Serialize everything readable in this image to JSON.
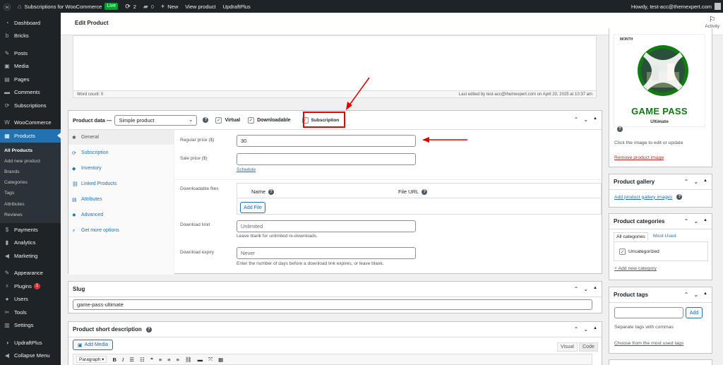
{
  "adminbar": {
    "site_name": "Subscriptions for WooCommerce",
    "live_badge": "Live",
    "updates_count": "2",
    "comments_count": "0",
    "new_label": "New",
    "view_product": "View product",
    "updraft": "UpdraftPlus",
    "howdy": "Howdy, test-acc@themexpert.com"
  },
  "sidebar": {
    "items": [
      {
        "label": "Dashboard",
        "icon": "dashboard-icon"
      },
      {
        "label": "Bricks",
        "icon": "bricks-icon"
      },
      {
        "label": "Posts",
        "icon": "pin-icon"
      },
      {
        "label": "Media",
        "icon": "media-icon"
      },
      {
        "label": "Pages",
        "icon": "pages-icon"
      },
      {
        "label": "Comments",
        "icon": "comments-icon"
      },
      {
        "label": "Subscriptions",
        "icon": "subscriptions-icon"
      },
      {
        "label": "WooCommerce",
        "icon": "woocommerce-icon"
      },
      {
        "label": "Products",
        "icon": "products-icon"
      }
    ],
    "submenu": [
      "All Products",
      "Add new product",
      "Brands",
      "Categories",
      "Tags",
      "Attributes",
      "Reviews"
    ],
    "items2": [
      {
        "label": "Payments",
        "icon": "payments-icon"
      },
      {
        "label": "Analytics",
        "icon": "analytics-icon"
      },
      {
        "label": "Marketing",
        "icon": "marketing-icon"
      },
      {
        "label": "Appearance",
        "icon": "appearance-icon"
      },
      {
        "label": "Plugins",
        "icon": "plugins-icon",
        "badge": "1"
      },
      {
        "label": "Users",
        "icon": "users-icon"
      },
      {
        "label": "Tools",
        "icon": "tools-icon"
      },
      {
        "label": "Settings",
        "icon": "settings-icon"
      },
      {
        "label": "UpdraftPlus",
        "icon": "updraftplus-icon"
      },
      {
        "label": "Collapse Menu",
        "icon": "collapse-icon"
      }
    ]
  },
  "header": {
    "title": "Edit Product",
    "activity": "Activity"
  },
  "editor": {
    "word_count": "Word count: 0",
    "last_edited": "Last edited by test-acc@themexpert.com on April 20, 2025 at 10:37 am"
  },
  "product_data": {
    "label": "Product data —",
    "type_selected": "Simple product",
    "virtual": "Virtual",
    "downloadable": "Downloadable",
    "subscription": "Subscription",
    "tabs": [
      {
        "label": "General",
        "icon": "wrench-icon"
      },
      {
        "label": "Subscription",
        "icon": "refresh-icon"
      },
      {
        "label": "Inventory",
        "icon": "tag-icon"
      },
      {
        "label": "Linked Products",
        "icon": "link-icon"
      },
      {
        "label": "Attributes",
        "icon": "list-icon"
      },
      {
        "label": "Advanced",
        "icon": "gear-icon"
      },
      {
        "label": "Get more options",
        "icon": "plugin-icon"
      }
    ],
    "regular_price_label": "Regular price ($)",
    "regular_price_value": "30",
    "sale_price_label": "Sale price ($)",
    "schedule": "Schedule",
    "downloadable_files_label": "Downloadable files",
    "col_name": "Name",
    "col_file_url": "File URL",
    "add_file": "Add File",
    "download_limit_label": "Download limit",
    "download_limit_placeholder": "Unlimited",
    "download_limit_desc": "Leave blank for unlimited re-downloads.",
    "download_expiry_label": "Download expiry",
    "download_expiry_placeholder": "Never",
    "download_expiry_desc": "Enter the number of days before a download link expires, or leave blank."
  },
  "slug": {
    "title": "Slug",
    "value": "game-pass-ultimate"
  },
  "short_desc": {
    "title": "Product short description",
    "add_media": "Add Media",
    "visual": "Visual",
    "code": "Code",
    "paragraph": "Paragraph"
  },
  "product_image": {
    "month_label": "MONTH",
    "game_pass": "GAME PASS",
    "ultimate": "Ultimate",
    "click_hint": "Click the image to edit or update",
    "remove": "Remove product image"
  },
  "gallery": {
    "title": "Product gallery",
    "add_link": "Add product gallery images"
  },
  "categories": {
    "title": "Product categories",
    "tab_all": "All categories",
    "tab_most": "Most Used",
    "item": "Uncategorized",
    "add_new": "+ Add new category"
  },
  "tags": {
    "title": "Product tags",
    "add_btn": "Add",
    "hint": "Separate tags with commas",
    "choose": "Choose from the most used tags"
  },
  "colors": {
    "accent": "#2271b1",
    "sidebar": "#1d2327",
    "annotation": "#e00000",
    "gamepass_green": "#107c10"
  }
}
